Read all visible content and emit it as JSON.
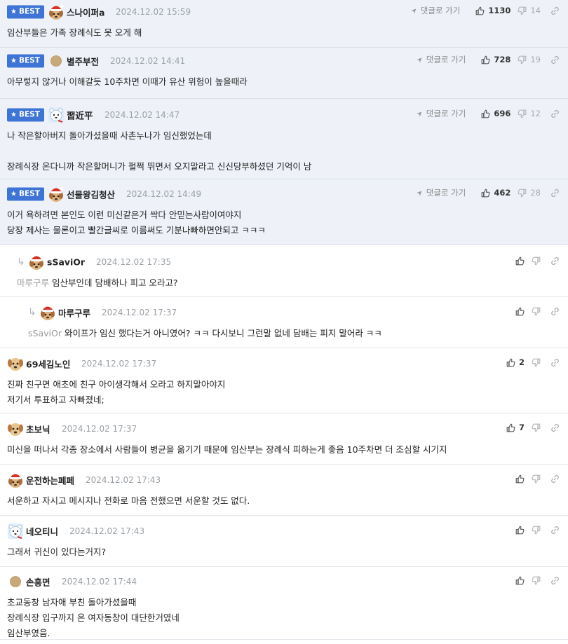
{
  "labels": {
    "best": "BEST",
    "goto": "댓글로 가기"
  },
  "comments": [
    {
      "best": true,
      "avatar": "dog-santa-avatar",
      "nick": "스나이퍼a",
      "date": "2024.12.02 15:59",
      "up": "1130",
      "down": "14",
      "lines": [
        "임산부들은 가족 장례식도 못 오게 해"
      ]
    },
    {
      "best": true,
      "avatar": "brown-dot-avatar",
      "nick": "별주부전",
      "date": "2024.12.02 14:41",
      "up": "728",
      "down": "19",
      "lines": [
        "아무렇지 않거나 이해갈듯 10주차면 이때가 유산 위험이 높을때라"
      ]
    },
    {
      "best": true,
      "avatar": "polar-bear-avatar",
      "nick": "習近平",
      "date": "2024.12.02 14:47",
      "up": "696",
      "down": "12",
      "lines": [
        "나 작은할아버지 돌아가셨을때 사촌누나가 임신했었는데",
        "",
        "장례식장 온다니까 작은할머니가 펄쩍 뛰면서 오지말라고 신신당부하셨던 기억이 남"
      ]
    },
    {
      "best": true,
      "avatar": "dog-santa-avatar",
      "nick": "선물왕김청산",
      "date": "2024.12.02 14:49",
      "up": "462",
      "down": "28",
      "lines": [
        "이거 욕하려면 본인도 이런 미신같은거 싹다 안믿는사람이여야지",
        "당장 제사는 물론이고 빨간글씨로 이름써도 기분나빠하면안되고 ㅋㅋㅋ"
      ]
    },
    {
      "reply": 1,
      "avatar": "dog-santa-avatar",
      "nick": "sSaviOr",
      "date": "2024.12.02 17:35",
      "up": "",
      "down": "",
      "mention": "마루구루",
      "lines": [
        "임산부인데 담배하나 피고 오라고?"
      ]
    },
    {
      "reply": 2,
      "avatar": "dog-santa-avatar",
      "nick": "마루구루",
      "date": "2024.12.02 17:37",
      "up": "",
      "down": "",
      "mention": "sSaviOr",
      "lines": [
        "와이프가 임신 했다는거 아니였어? ㅋㅋ 다시보니 그런말 없네 담배는 피지 말어라 ㅋㅋ"
      ]
    },
    {
      "avatar": "puppy-avatar",
      "nick": "69세김노인",
      "date": "2024.12.02 17:37",
      "up": "2",
      "down": "",
      "lines": [
        "진짜 친구면 애초에 친구 아이생각해서 오라고 하지말아야지",
        "저기서 투표하고 자빠졌네;"
      ]
    },
    {
      "avatar": "puppy-avatar",
      "nick": "초보닉",
      "date": "2024.12.02 17:37",
      "up": "7",
      "down": "",
      "lines": [
        "미신을 떠나서 각종 장소에서 사람들이 병균을 옮기기 때문에 임산부는 장례식 피하는게 좋음 10주차면 더 조심할 시기지"
      ]
    },
    {
      "avatar": "dog-santa-avatar",
      "nick": "운전하는페페",
      "date": "2024.12.02 17:43",
      "up": "",
      "down": "",
      "lines": [
        "서운하고 자시고 메시지나 전화로 마음 전했으면 서운할 것도 없다."
      ]
    },
    {
      "avatar": "polar-bear-avatar",
      "nick": "네오티니",
      "date": "2024.12.02 17:43",
      "up": "",
      "down": "",
      "lines": [
        "그래서 귀신이 있다는거지?"
      ]
    },
    {
      "avatar": "brown-dot-avatar",
      "nick": "손흥면",
      "date": "2024.12.02 17:44",
      "up": "",
      "down": "",
      "lines": [
        "초교동창 남자애 부친 돌아가셨을때",
        "장례식장 입구까지 온 여자동창이 대단한거였네",
        "임산부였음."
      ]
    }
  ]
}
